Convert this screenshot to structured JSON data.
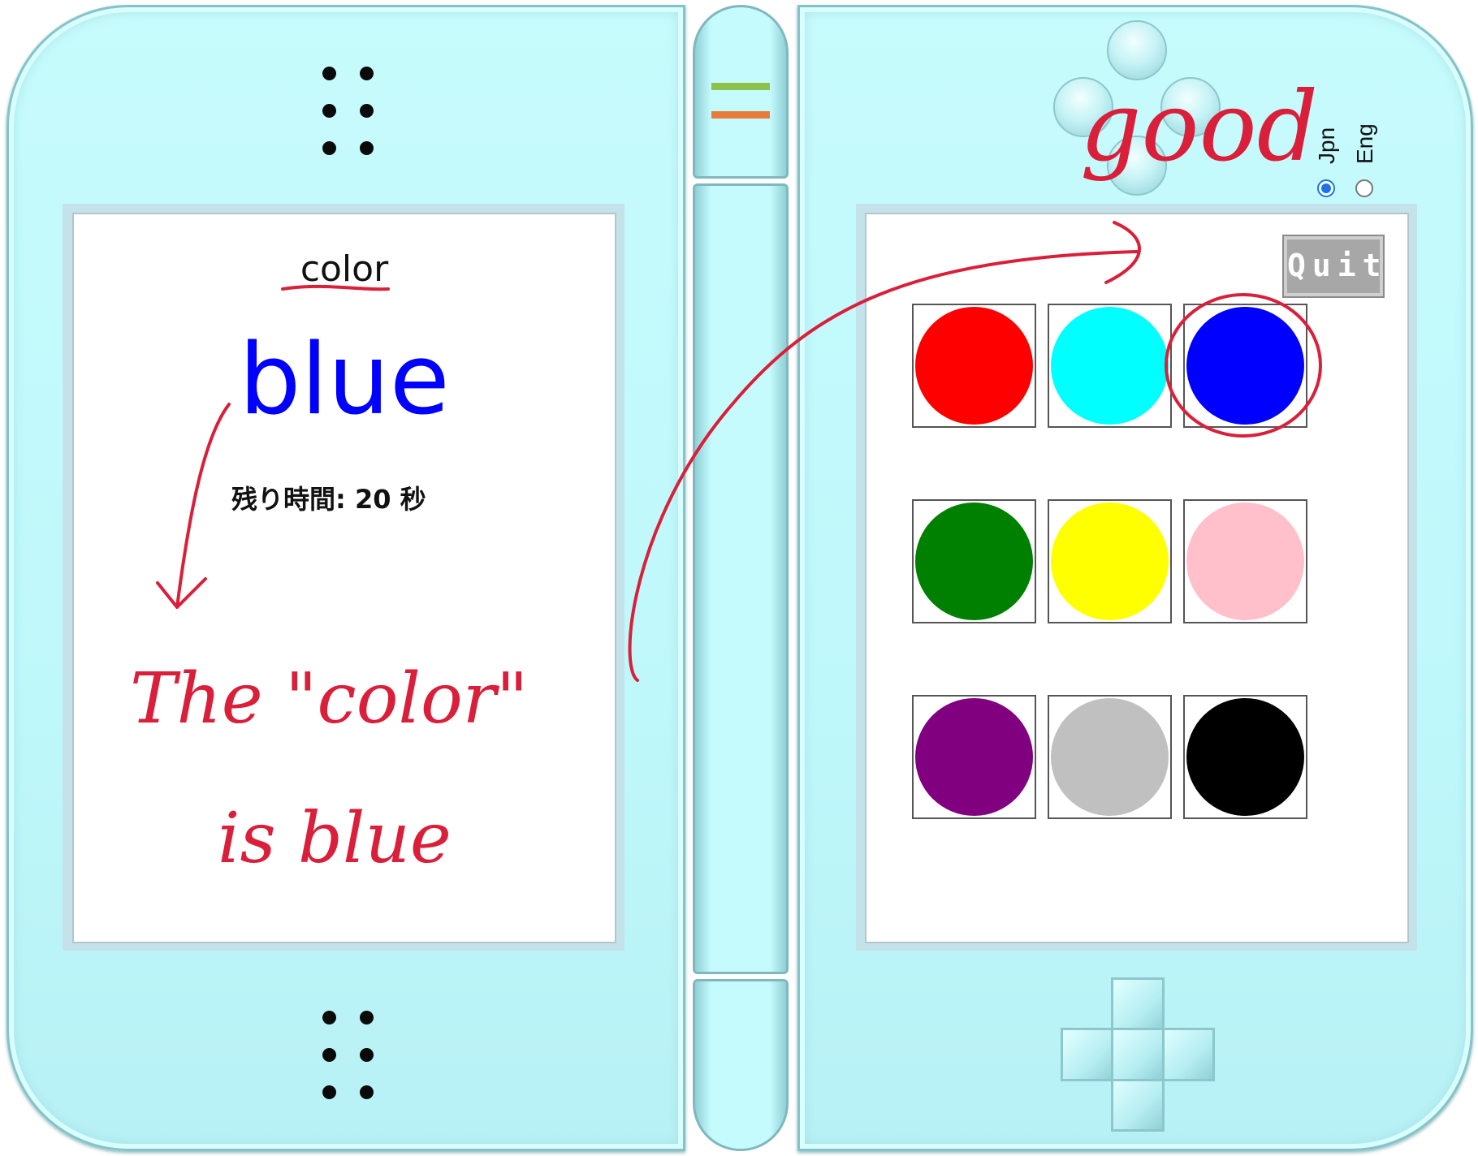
{
  "left_screen": {
    "category_label": "color",
    "word": "blue",
    "word_color": "#0000ff",
    "timer_label": "残り時間: 20 秒"
  },
  "right_screen": {
    "quit_label": "Quit",
    "color_options": [
      {
        "color": "#ff0000",
        "selected": false
      },
      {
        "color": "#00ffff",
        "selected": false
      },
      {
        "color": "#0000ff",
        "selected": true
      },
      {
        "color": "#008000",
        "selected": false
      },
      {
        "color": "#ffff00",
        "selected": false
      },
      {
        "color": "#ffc0cb",
        "selected": false
      },
      {
        "color": "#800080",
        "selected": false
      },
      {
        "color": "#c0c0c0",
        "selected": false
      },
      {
        "color": "#000000",
        "selected": false
      }
    ]
  },
  "language": {
    "options": [
      "Jpn",
      "Eng"
    ],
    "selected": "Jpn"
  },
  "annotations": {
    "good": "good",
    "explanation_line1": "The \"color\"",
    "explanation_line2": "is blue",
    "ink_color": "#d91f3a"
  },
  "hinge": {
    "stripe_colors": [
      "#8bc34a",
      "#e87a3a"
    ]
  },
  "icons": [
    "speaker-grille-icon",
    "radio-icon",
    "action-buttons-icon",
    "dpad-icon",
    "arrow-icon"
  ]
}
